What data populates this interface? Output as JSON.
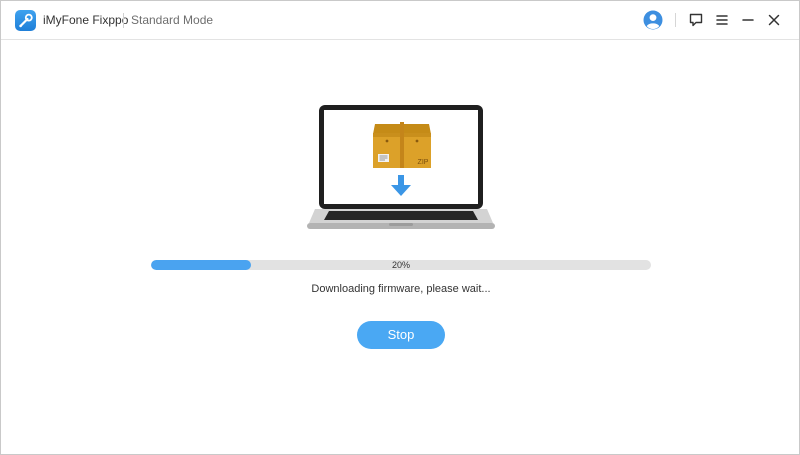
{
  "window": {
    "app_title": "iMyFone Fixppo",
    "mode": "Standard Mode"
  },
  "titlebar_icons": [
    "wrench-logo-icon",
    "user-avatar-icon",
    "feedback-icon",
    "menu-icon",
    "minimize-icon",
    "close-icon"
  ],
  "illustration": {
    "archive_label": "ZIP",
    "icons": [
      "laptop-icon",
      "zip-box-icon",
      "download-arrow-icon"
    ]
  },
  "progress": {
    "percent": 20,
    "label": "20%",
    "status": "Downloading firmware, please wait..."
  },
  "actions": {
    "stop_label": "Stop"
  },
  "colors": {
    "accent": "#4aa3f0",
    "track": "#e2e2e2",
    "box": "#d9a024"
  }
}
